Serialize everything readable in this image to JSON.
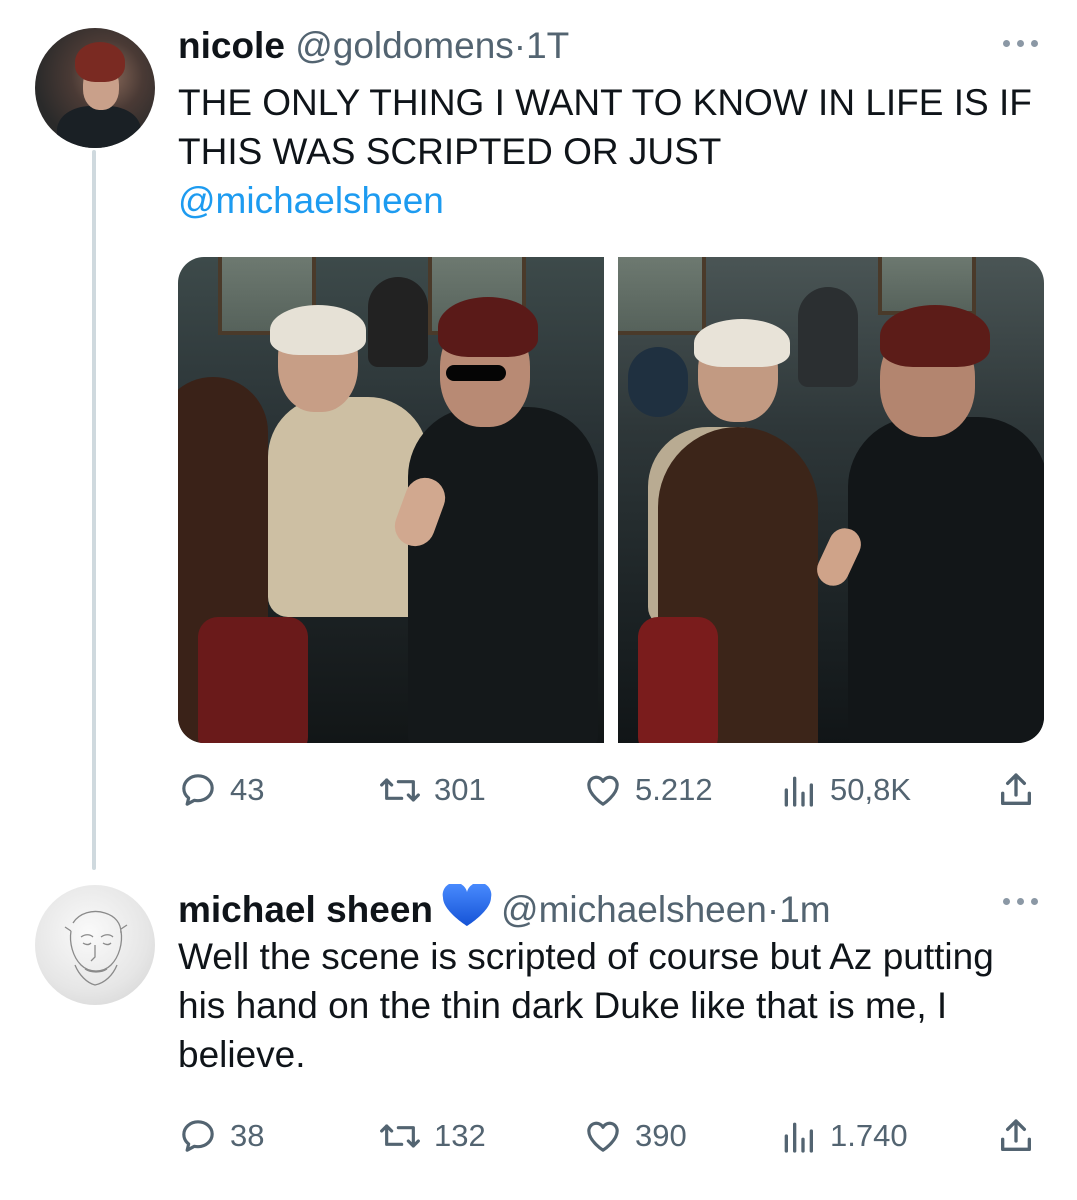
{
  "tweets": [
    {
      "name": "nicole",
      "handle": "@goldomens",
      "separator": "·",
      "time": "1T",
      "text": "THE ONLY THING I WANT TO KNOW IN LIFE IS IF THIS WAS SCRIPTED OR JUST",
      "mention": "@michaelsheen",
      "stats": {
        "replies": "43",
        "retweets": "301",
        "likes": "5.212",
        "views": "50,8K"
      }
    },
    {
      "name": "michael sheen",
      "badge_icon": "blue-heart-icon",
      "handle": "@michaelsheen",
      "separator": "·",
      "time": "1m",
      "text": "Well the scene is scripted of course but Az putting his hand on the thin dark Duke like that is me, I believe.",
      "stats": {
        "replies": "38",
        "retweets": "132",
        "likes": "390",
        "views": "1.740"
      }
    }
  ],
  "colors": {
    "text": "#0f1419",
    "secondary": "#536471",
    "link": "#1d9bf0",
    "badge": "#1d6ff0",
    "thread_line": "#cfd9de"
  },
  "icons": [
    "reply-icon",
    "retweet-icon",
    "like-icon",
    "views-icon",
    "share-icon",
    "more-icon"
  ]
}
